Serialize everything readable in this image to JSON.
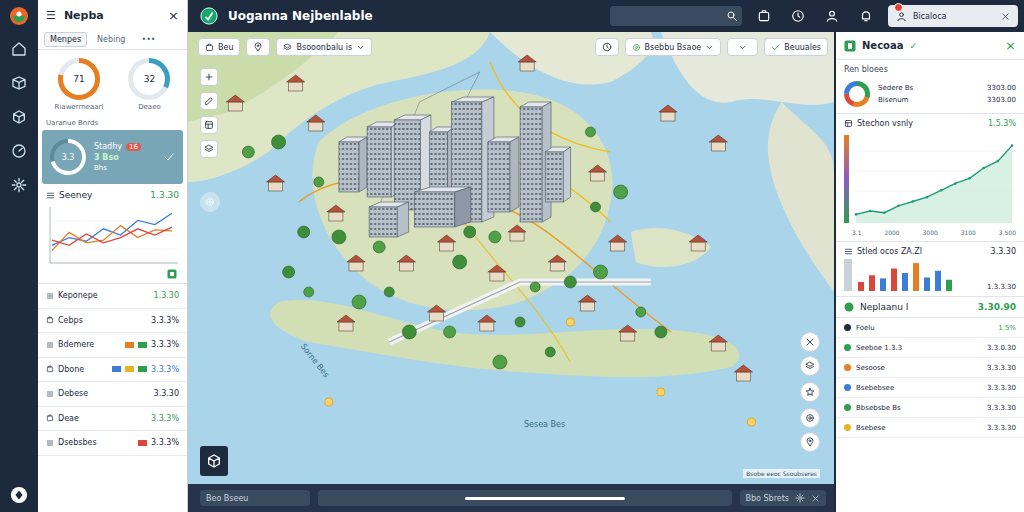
{
  "topbar": {
    "title": "Uoganna Nejbenlable",
    "user": {
      "label": "Bicaloca",
      "alert": true
    }
  },
  "left_panel": {
    "menu": "☰",
    "title": "Nepba",
    "close": "×",
    "tabs": [
      {
        "label": "Menpes",
        "selected": true
      },
      {
        "label": "Nebing",
        "selected": false
      },
      {
        "label": "•••",
        "selected": false
      }
    ],
    "donuts": [
      {
        "value": "71",
        "label": "Riawerrneaarl",
        "level": 0.78,
        "color": "#e67e22"
      },
      {
        "value": "32",
        "label": "Deaeo",
        "level": 0.32,
        "color": "#3a9ec2"
      }
    ],
    "section": "Uaranue Bnrds",
    "card": {
      "value": "3.3",
      "level": 0.7,
      "title": "Stadhy",
      "badge": "16",
      "sub": "3 Bso",
      "caption": "Bhs"
    },
    "chart": {
      "title": "Seeney",
      "value": "1.3.30",
      "series": [
        {
          "color": "#3b7dd8",
          "values": [
            30,
            45,
            38,
            62,
            50,
            78,
            70,
            92
          ]
        },
        {
          "color": "#e67e22",
          "values": [
            20,
            55,
            35,
            40,
            68,
            45,
            60,
            58
          ]
        },
        {
          "color": "#d9483b",
          "values": [
            40,
            30,
            52,
            35,
            45,
            62,
            50,
            65
          ]
        }
      ]
    },
    "rows": [
      {
        "label": "Keponepe",
        "value": "1.3.30",
        "value_color": "#2e9e4f",
        "tags": []
      },
      {
        "label": "Cebps",
        "value": "3.3.3%",
        "value_color": "#1e2b3f",
        "tags": []
      },
      {
        "label": "Bdemere",
        "value": "3.3.3%",
        "value_color": "#1e2b3f",
        "tags": [
          "#e67e22",
          "#2e9e4f"
        ]
      },
      {
        "label": "Dbone",
        "value": "3.3.3%",
        "value_color": "#3b7dd8",
        "tags": [
          "#3b7dd8",
          "#e6b422",
          "#2e9e4f"
        ]
      },
      {
        "label": "Debese",
        "value": "3.3.30",
        "value_color": "#1e2b3f",
        "tags": []
      },
      {
        "label": "Deae",
        "value": "3.3.3%",
        "value_color": "#2e9e4f",
        "tags": []
      },
      {
        "label": "Dsebsbes",
        "value": "3.3.3%",
        "value_color": "#1e2b3f",
        "tags": [
          "#d9483b"
        ]
      }
    ]
  },
  "map": {
    "toolbar": [
      {
        "label": "Beu",
        "kind": "button"
      },
      {
        "label": "Bsooonbalu is",
        "kind": "dropdown"
      },
      {
        "label": "Bsebbu Bsaoe",
        "kind": "dropdown"
      },
      {
        "label": "Beuuales",
        "kind": "button"
      }
    ],
    "labels": [
      {
        "text": "Sorne Bes"
      },
      {
        "text": "Sesea Bes"
      }
    ],
    "attribution": "Bsobe eeoc Ssoubseres"
  },
  "bottom_bar": {
    "left": "Beo Bseeu",
    "right": "Bbo Sbrets",
    "scroll": 0.55
  },
  "right_panel": {
    "title": "Necoaa",
    "check": "✓",
    "close": "×",
    "subtitle": "Ren bloees",
    "donut": [
      {
        "share": 0.3,
        "color": "#2e9e4f"
      },
      {
        "share": 0.25,
        "color": "#e67e22"
      },
      {
        "share": 0.2,
        "color": "#d9483b"
      },
      {
        "share": 0.25,
        "color": "#3b7dd8"
      }
    ],
    "stats": [
      {
        "label": "Sedere Bs",
        "value": "3303.00"
      },
      {
        "label": "Bisenum",
        "value": "3303.00"
      }
    ],
    "area_chart": {
      "title": "Stechon vsnly",
      "value": "1.5.3%",
      "values": [
        10,
        14,
        12,
        20,
        25,
        30,
        38,
        46,
        52,
        64,
        72,
        90
      ],
      "ticks": [
        "3.1",
        "2000",
        "3000",
        "3100",
        "3.500"
      ]
    },
    "bar_chart": {
      "title": "Stled ocos ZA.Zl",
      "value": "3.3.30",
      "total": "1.3.3.30",
      "bars": [
        {
          "value": 20,
          "color": "#d9483b"
        },
        {
          "value": 35,
          "color": "#d9483b"
        },
        {
          "value": 28,
          "color": "#3b7dd8"
        },
        {
          "value": 50,
          "color": "#d9483b"
        },
        {
          "value": 40,
          "color": "#3b7dd8"
        },
        {
          "value": 62,
          "color": "#e67e22"
        },
        {
          "value": 30,
          "color": "#3b7dd8"
        },
        {
          "value": 45,
          "color": "#3b7dd8"
        },
        {
          "value": 25,
          "color": "#2e9e4f"
        }
      ]
    },
    "summary": {
      "title": "Neplaanu I",
      "value": "3.30.90"
    },
    "rows": [
      {
        "label": "Foelu",
        "value": "1.5%",
        "color": "#1e2b3f"
      },
      {
        "label": "Seeboe 1.3.3",
        "value": "3.3.0.30",
        "color": "#2e9e4f"
      },
      {
        "label": "Sesoose",
        "value": "3.3.3.30",
        "color": "#e67e22"
      },
      {
        "label": "Bsebebsee",
        "value": "3.3.3.30",
        "color": "#3b7dd8"
      },
      {
        "label": "Bbsebsbe Bs",
        "value": "3.3.3.30",
        "color": "#2e9e4f"
      },
      {
        "label": "Bsebese",
        "value": "3.3.3.30",
        "color": "#e6b422"
      }
    ]
  }
}
